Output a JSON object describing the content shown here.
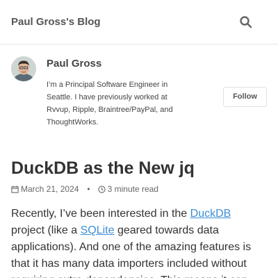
{
  "header": {
    "site_title": "Paul Gross's Blog",
    "search_icon": "search-icon"
  },
  "author": {
    "avatar_icon": "avatar",
    "name": "Paul Gross",
    "bio": "I’m a Principal Software Engineer in Seattle. I have previously worked at Rvvup, Ripple, Braintree/PayPal, and ThoughtWorks.",
    "follow_label": "Follow"
  },
  "post": {
    "title": "DuckDB as the New jq",
    "date": "March 21, 2024",
    "separator": "•",
    "read_time": "3 minute read",
    "calendar_icon": "calendar-icon",
    "clock_icon": "clock-icon",
    "body": {
      "text_1": "Recently, I’ve been interested in the ",
      "link_1": "DuckDB",
      "text_2": " project (like a ",
      "link_2": "SQLite",
      "text_3": " geared towards data applications). And one of the amazing features is that it has many data importers included without requiring extra dependencies. This means it can"
    }
  },
  "colors": {
    "link": "#3d8ed6",
    "text": "#333333",
    "muted": "#666666"
  }
}
